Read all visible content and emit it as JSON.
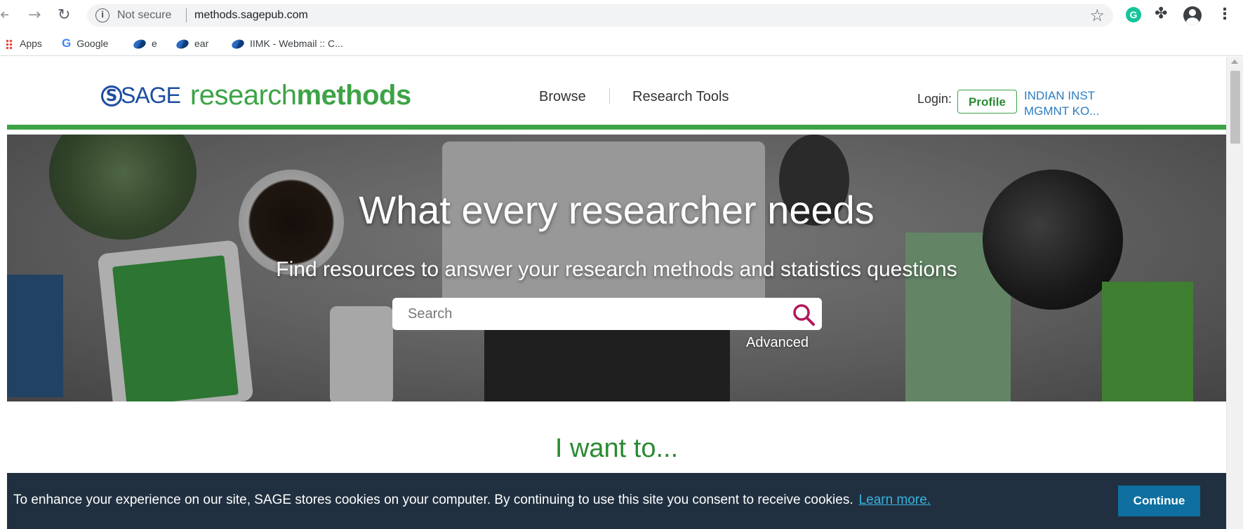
{
  "browser": {
    "not_secure": "Not secure",
    "url": "methods.sagepub.com",
    "ext_g_letter": "G"
  },
  "bookmarks": [
    {
      "label": "Apps"
    },
    {
      "label": "Google"
    },
    {
      "label": "e"
    },
    {
      "label": "ear"
    },
    {
      "label": "IIMK - Webmail :: C..."
    }
  ],
  "site": {
    "logo_s": "S",
    "logo_sage": "SAGE",
    "logo_research": "research",
    "logo_methods": "methods",
    "nav": [
      "Browse",
      "Research Tools"
    ],
    "login_label": "Login:",
    "profile_button": "Profile",
    "institution_line1": "INDIAN INST",
    "institution_line2": "MGMNT KO..."
  },
  "hero": {
    "title": "What every researcher needs",
    "subtitle": "Find resources to answer your research methods and statistics questions",
    "search_placeholder": "Search",
    "advanced": "Advanced"
  },
  "main": {
    "want_heading": "I want to..."
  },
  "cookie": {
    "text": "To enhance your experience on our site, SAGE stores cookies on your computer. By continuing to use this site you consent to receive cookies.",
    "learn_more": "Learn more.",
    "continue": "Continue"
  },
  "colors": {
    "brand_green": "#3da346",
    "brand_blue": "#1d4ea0",
    "cookie_bg": "#203040",
    "continue_bg": "#0e6fa0",
    "search_icon": "#b0185a"
  }
}
